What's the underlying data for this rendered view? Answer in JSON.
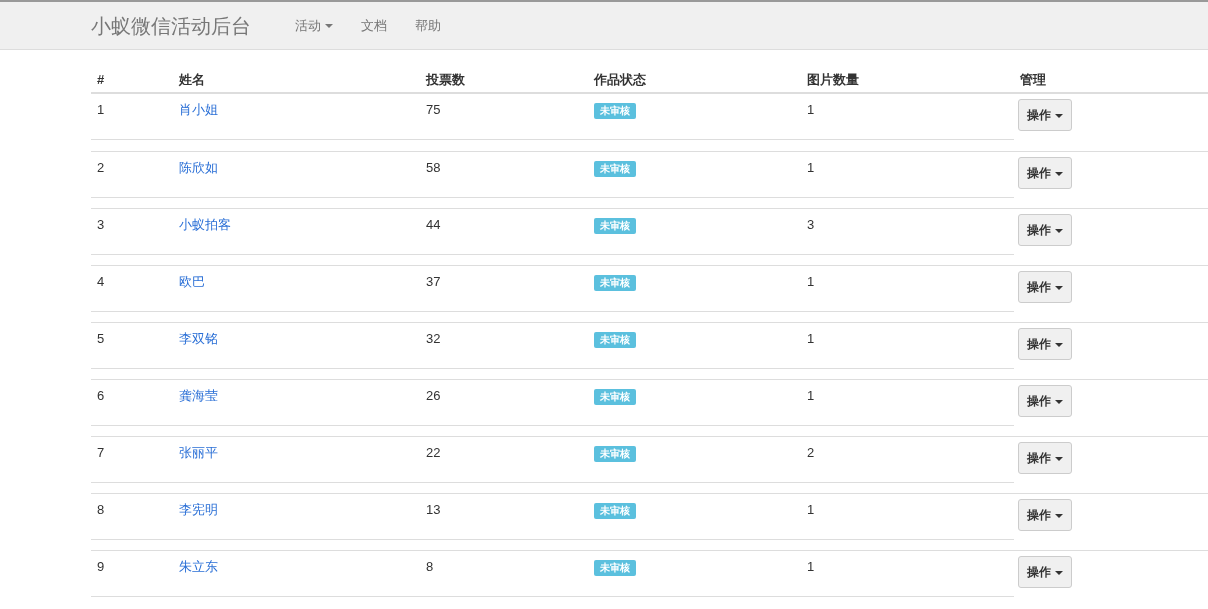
{
  "navbar": {
    "brand": "小蚁微信活动后台",
    "items": [
      {
        "label": "活动",
        "dropdown": true
      },
      {
        "label": "文档",
        "dropdown": false
      },
      {
        "label": "帮助",
        "dropdown": false
      }
    ]
  },
  "table": {
    "columns": [
      "#",
      "姓名",
      "投票数",
      "作品状态",
      "图片数量",
      "管理"
    ],
    "rows": [
      {
        "index": "1",
        "name": "肖小姐",
        "votes": "75",
        "status": "未审核",
        "images": "1",
        "action": "操作"
      },
      {
        "index": "2",
        "name": "陈欣如",
        "votes": "58",
        "status": "未审核",
        "images": "1",
        "action": "操作"
      },
      {
        "index": "3",
        "name": "小蚁拍客",
        "votes": "44",
        "status": "未审核",
        "images": "3",
        "action": "操作"
      },
      {
        "index": "4",
        "name": "欧巴",
        "votes": "37",
        "status": "未审核",
        "images": "1",
        "action": "操作"
      },
      {
        "index": "5",
        "name": "李双铭",
        "votes": "32",
        "status": "未审核",
        "images": "1",
        "action": "操作"
      },
      {
        "index": "6",
        "name": "龚海莹",
        "votes": "26",
        "status": "未审核",
        "images": "1",
        "action": "操作"
      },
      {
        "index": "7",
        "name": "张丽平",
        "votes": "22",
        "status": "未审核",
        "images": "2",
        "action": "操作"
      },
      {
        "index": "8",
        "name": "李宪明",
        "votes": "13",
        "status": "未审核",
        "images": "1",
        "action": "操作"
      },
      {
        "index": "9",
        "name": "朱立东",
        "votes": "8",
        "status": "未审核",
        "images": "1",
        "action": "操作"
      }
    ]
  }
}
